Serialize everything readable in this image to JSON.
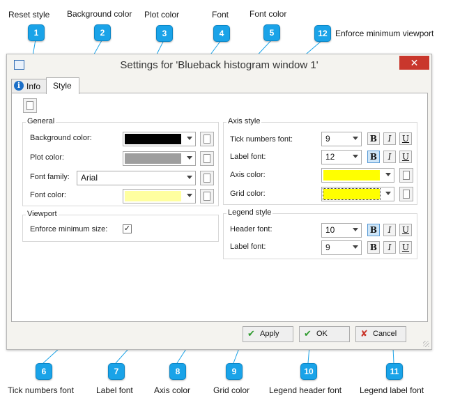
{
  "callouts": {
    "c1": {
      "num": "1",
      "label": "Reset style"
    },
    "c2": {
      "num": "2",
      "label": "Background color"
    },
    "c3": {
      "num": "3",
      "label": "Plot color"
    },
    "c4": {
      "num": "4",
      "label": "Font"
    },
    "c5": {
      "num": "5",
      "label": "Font color"
    },
    "c12": {
      "num": "12",
      "label": "Enforce minimum viewport"
    },
    "c6": {
      "num": "6",
      "label": "Tick numbers font"
    },
    "c7": {
      "num": "7",
      "label": "Label font"
    },
    "c8": {
      "num": "8",
      "label": "Axis color"
    },
    "c9": {
      "num": "9",
      "label": "Grid color"
    },
    "c10": {
      "num": "10",
      "label": "Legend header font"
    },
    "c11": {
      "num": "11",
      "label": "Legend label font"
    }
  },
  "window": {
    "title": "Settings for 'Blueback histogram window 1'",
    "close_glyph": "✕"
  },
  "tabs": {
    "info": "Info",
    "style": "Style",
    "info_icon": "info-icon"
  },
  "general": {
    "title": "General",
    "background_label": "Background color:",
    "background_color": "#000000",
    "plot_label": "Plot color:",
    "plot_color": "#9e9e9e",
    "font_family_label": "Font family:",
    "font_family_value": "Arial",
    "font_color_label": "Font color:",
    "font_color": "#ffffa0"
  },
  "viewport": {
    "title": "Viewport",
    "enforce_label": "Enforce minimum size:",
    "enforce_checked": "✓"
  },
  "axis_style": {
    "title": "Axis style",
    "tick_label": "Tick numbers font:",
    "tick_size": "9",
    "label_font_label": "Label font:",
    "label_font_size": "12",
    "axis_color_label": "Axis color:",
    "axis_color": "#ffff00",
    "grid_color_label": "Grid color:",
    "grid_color": "#ffff00"
  },
  "legend_style": {
    "title": "Legend style",
    "header_label": "Header font:",
    "header_size": "10",
    "label_font_label": "Label font:",
    "label_font_size": "9"
  },
  "font_buttons": {
    "bold": "B",
    "italic": "I",
    "underline": "U"
  },
  "buttons": {
    "apply": "Apply",
    "apply_icon": "✔",
    "ok": "OK",
    "ok_icon": "✔",
    "cancel": "Cancel",
    "cancel_icon": "✘"
  }
}
